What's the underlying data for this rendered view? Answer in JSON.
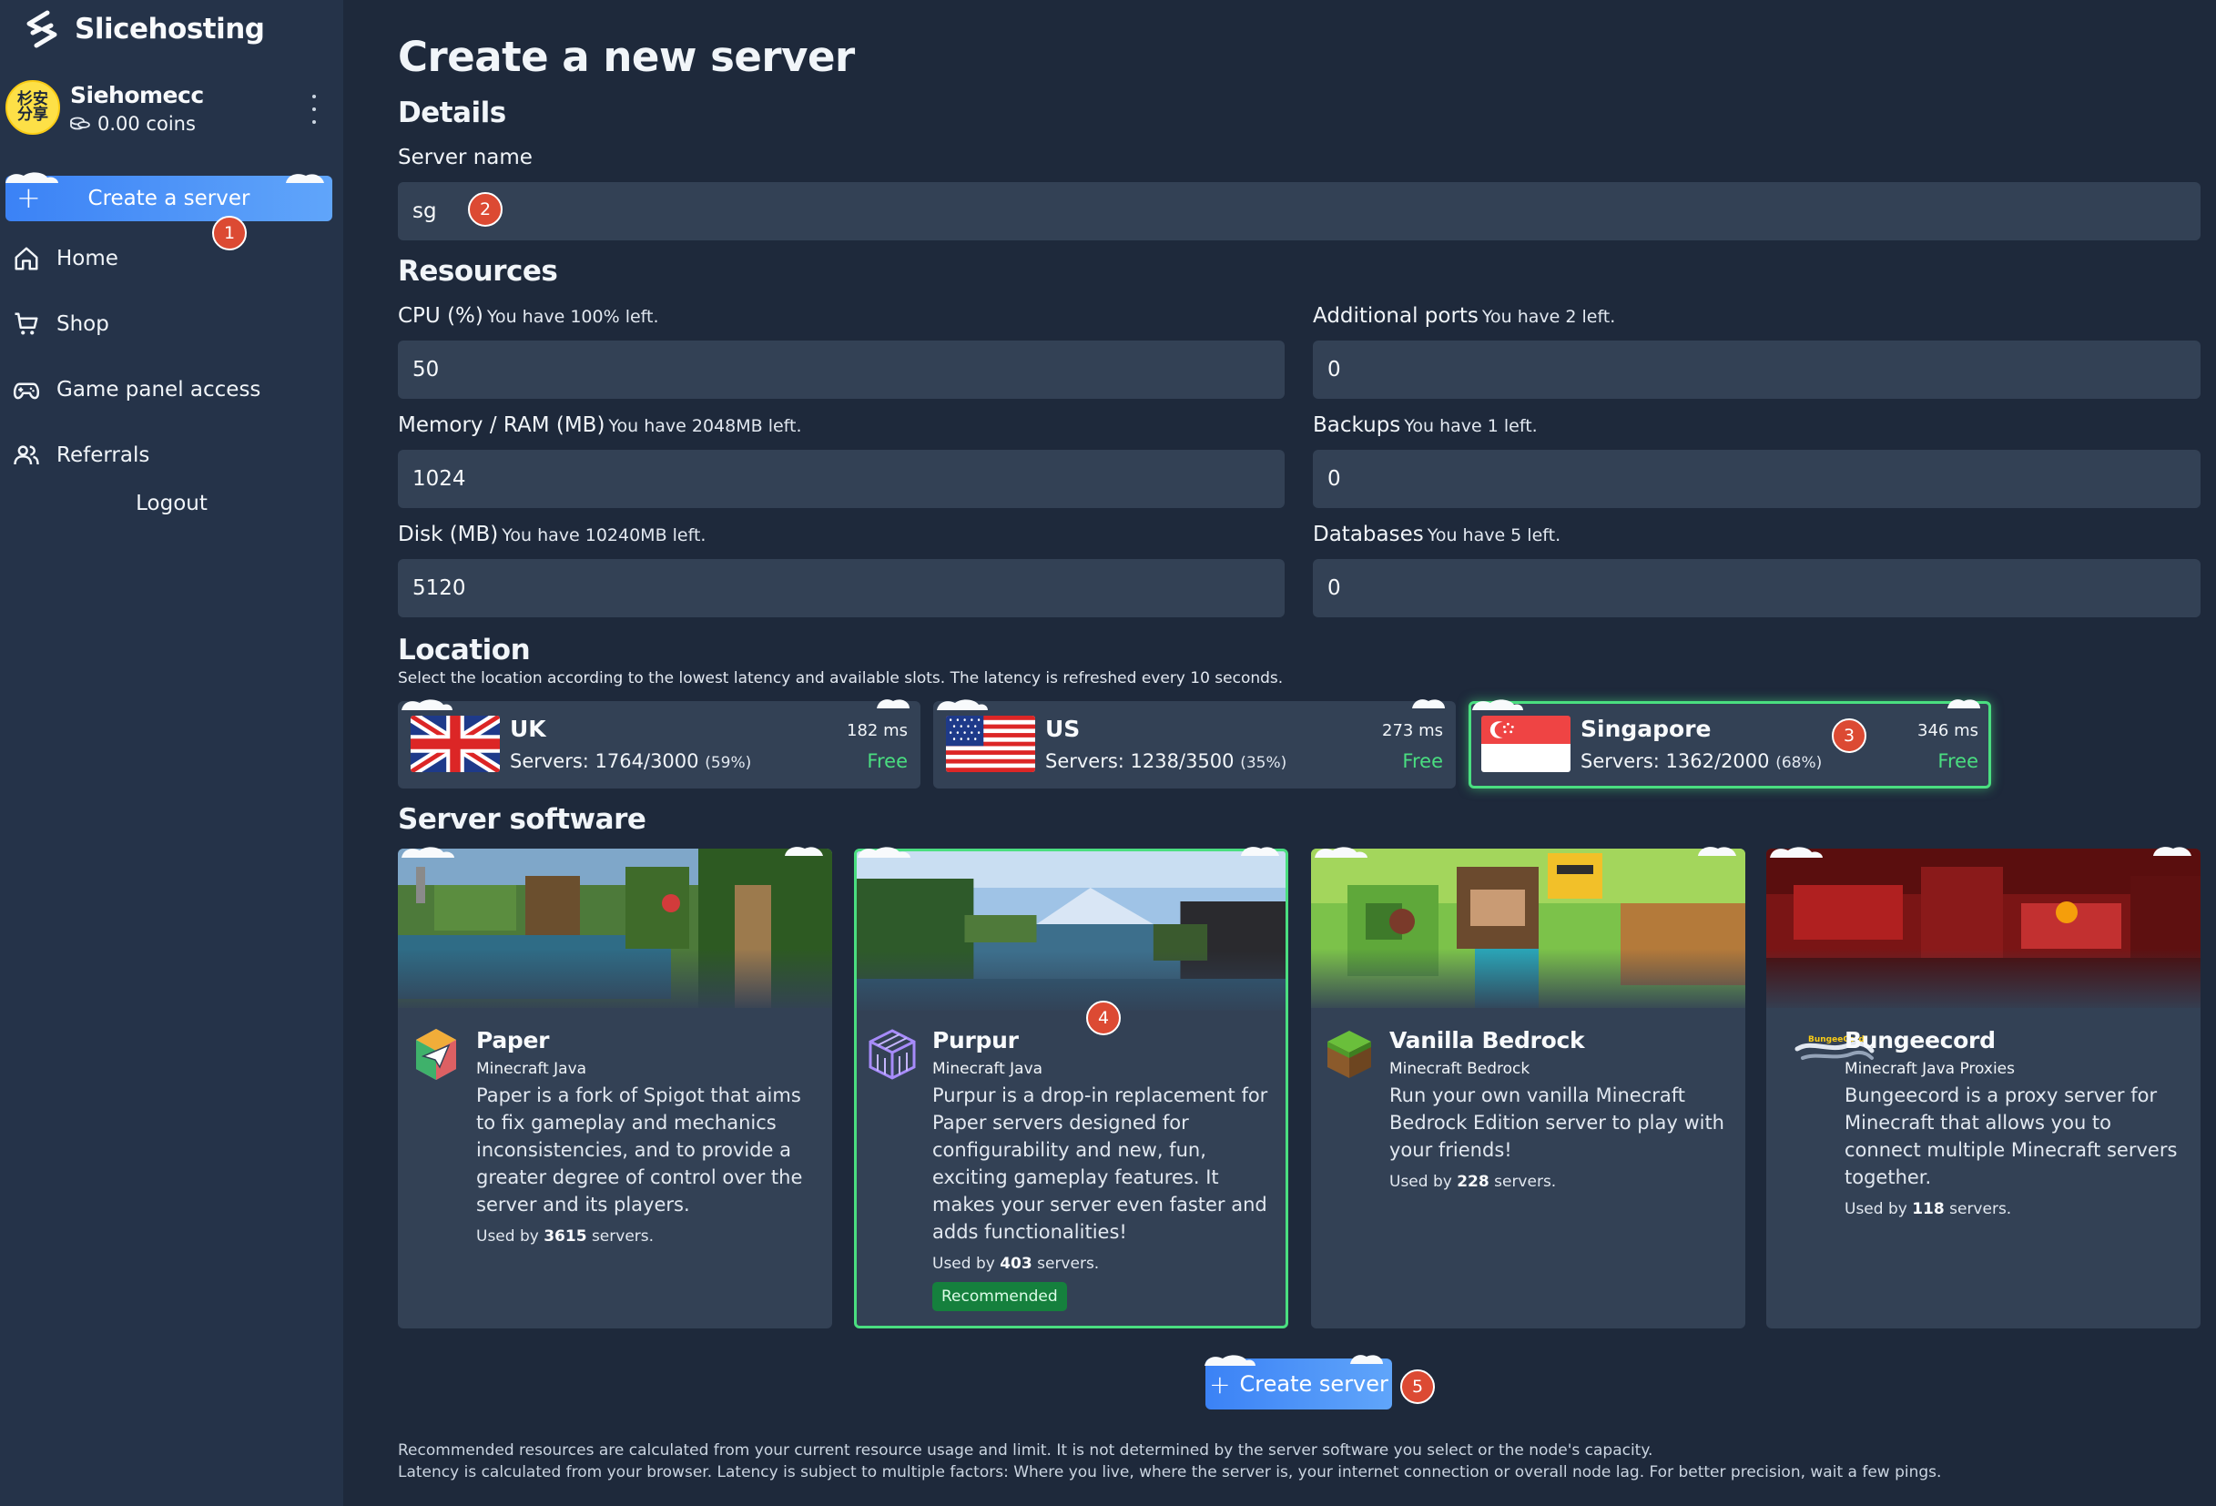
{
  "app": {
    "name": "Slicehosting"
  },
  "user": {
    "name": "Siehomecc",
    "coins": "0.00 coins",
    "avatar_text": "杉安 分享"
  },
  "sidebar": {
    "create_label": "Create a server",
    "items": [
      {
        "label": "Home",
        "icon": "home-icon"
      },
      {
        "label": "Shop",
        "icon": "cart-icon"
      },
      {
        "label": "Game panel access",
        "icon": "gamepad-icon"
      },
      {
        "label": "Referrals",
        "icon": "users-icon"
      }
    ],
    "logout_label": "Logout"
  },
  "page": {
    "title": "Create a new server",
    "details_heading": "Details",
    "server_name_label": "Server name",
    "server_name_value": "sg",
    "resources_heading": "Resources",
    "resources": [
      {
        "label": "CPU (%)",
        "hint": "You have 100% left.",
        "value": "50"
      },
      {
        "label": "Additional ports",
        "hint": "You have 2 left.",
        "value": "0"
      },
      {
        "label": "Memory / RAM (MB)",
        "hint": "You have 2048MB left.",
        "value": "1024"
      },
      {
        "label": "Backups",
        "hint": "You have 1 left.",
        "value": "0"
      },
      {
        "label": "Disk (MB)",
        "hint": "You have 10240MB left.",
        "value": "5120"
      },
      {
        "label": "Databases",
        "hint": "You have 5 left.",
        "value": "0"
      }
    ],
    "location_heading": "Location",
    "location_description": "Select the location according to the lowest latency and available slots. The latency is refreshed every 10 seconds.",
    "locations": [
      {
        "name": "UK",
        "servers": "Servers: 1764/3000",
        "percent": "(59%)",
        "latency": "182 ms",
        "price": "Free",
        "selected": false
      },
      {
        "name": "US",
        "servers": "Servers: 1238/3500",
        "percent": "(35%)",
        "latency": "273 ms",
        "price": "Free",
        "selected": false
      },
      {
        "name": "Singapore",
        "servers": "Servers: 1362/2000",
        "percent": "(68%)",
        "latency": "346 ms",
        "price": "Free",
        "selected": true
      }
    ],
    "software_heading": "Server software",
    "software": [
      {
        "name": "Paper",
        "type": "Minecraft Java",
        "description": "Paper is a fork of Spigot that aims to fix gameplay and mechanics inconsistencies, and to provide a greater degree of control over the server and its players.",
        "used_prefix": "Used by",
        "used_count": "3615",
        "used_suffix": "servers."
      },
      {
        "name": "Purpur",
        "type": "Minecraft Java",
        "description": "Purpur is a drop-in replacement for Paper servers designed for configurability and new, fun, exciting gameplay features. It makes your server even faster and adds functionalities!",
        "used_prefix": "Used by",
        "used_count": "403",
        "used_suffix": "servers.",
        "tag": "Recommended"
      },
      {
        "name": "Vanilla Bedrock",
        "type": "Minecraft Bedrock",
        "description": "Run your own vanilla Minecraft Bedrock Edition server to play with your friends!",
        "used_prefix": "Used by",
        "used_count": "228",
        "used_suffix": "servers."
      },
      {
        "name": "Bungeecord",
        "type": "Minecraft Java Proxies",
        "description": "Bungeecord is a proxy server for Minecraft that allows you to connect multiple Minecraft servers together.",
        "used_prefix": "Used by",
        "used_count": "118",
        "used_suffix": "servers.",
        "logo_text": "BungeeCord"
      }
    ],
    "create_button": "Create server",
    "footnotes": [
      "Recommended resources are calculated from your current resource usage and limit. It is not determined by the server software you select or the node's capacity.",
      "Latency is calculated from your browser. Latency is subject to multiple factors: Where you live, where the server is, your internet connection or overall node lag. For better precision, wait a few pings."
    ]
  },
  "annotations": [
    "1",
    "2",
    "3",
    "4",
    "5"
  ],
  "colors": {
    "background": "#1e293b",
    "sidebar": "#253349",
    "card": "#334155",
    "accent_blue": "#3b82f6",
    "accent_green": "#4ade80",
    "badge": "#dc4a33"
  }
}
